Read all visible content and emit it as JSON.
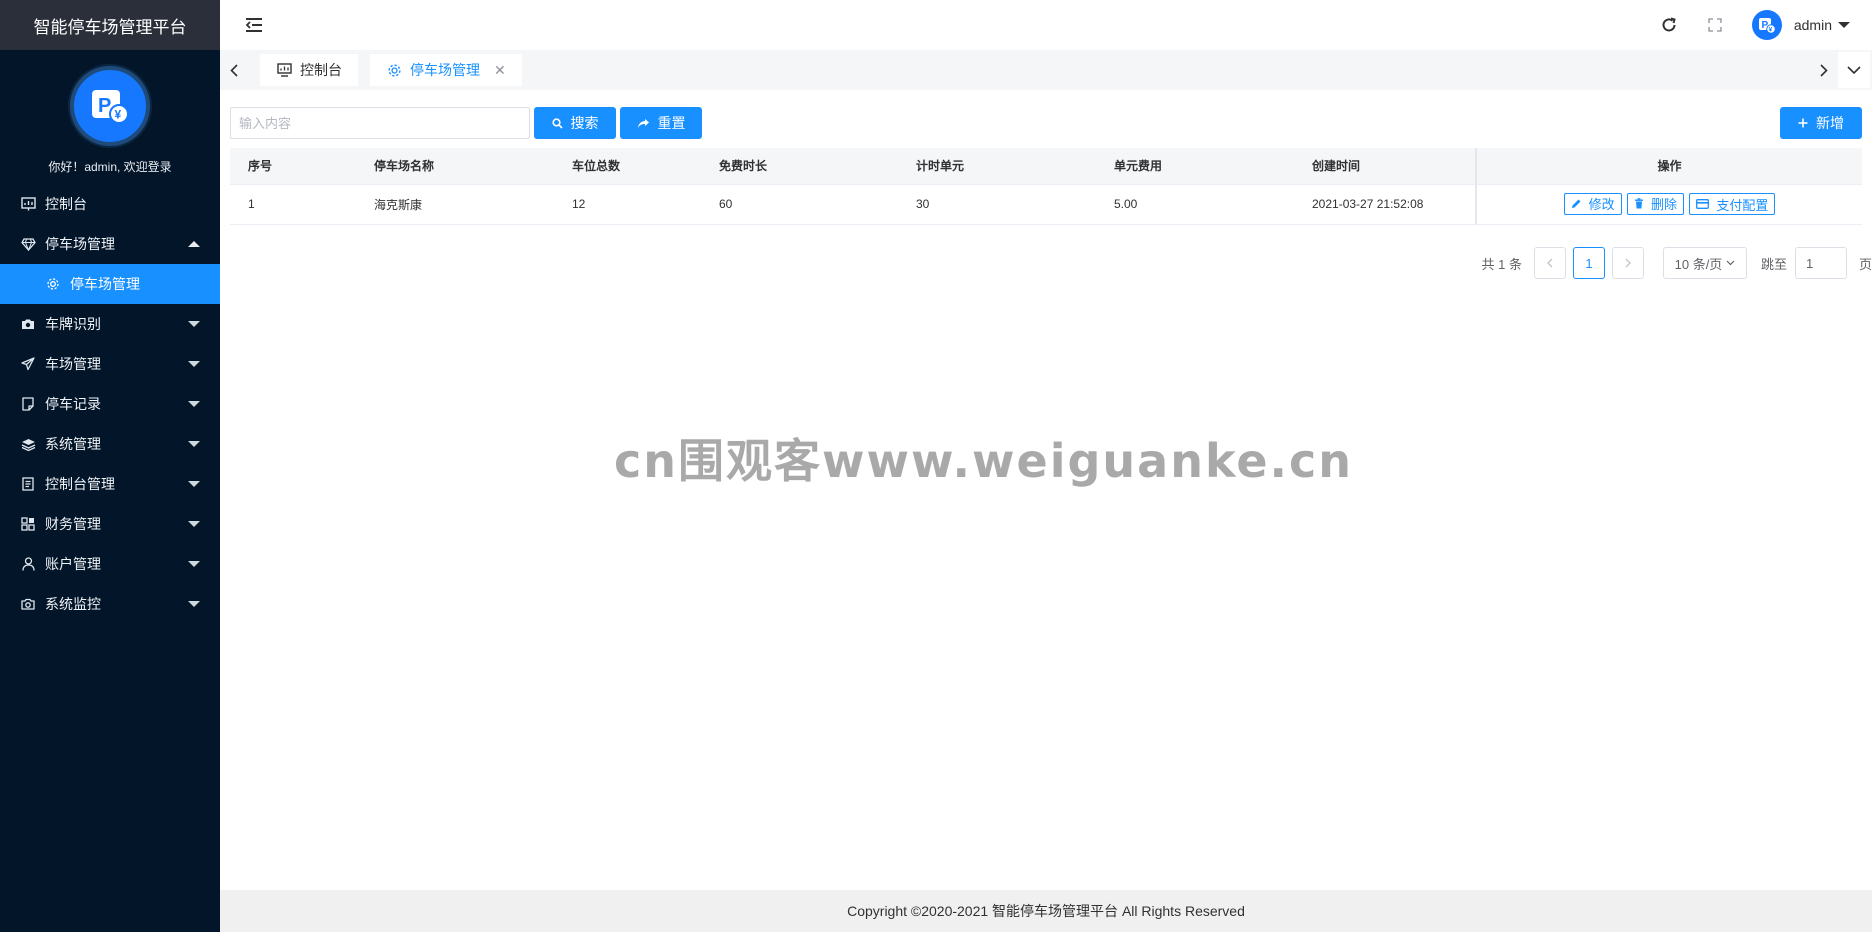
{
  "app": {
    "title": "智能停车场管理平台",
    "greeting": "你好！admin, 欢迎登录"
  },
  "sidebar": {
    "items": [
      {
        "label": "控制台",
        "icon": "dashboard-icon"
      },
      {
        "label": "停车场管理",
        "icon": "diamond-icon",
        "expanded": true
      },
      {
        "label": "停车场管理",
        "icon": "gear-icon",
        "active": true
      },
      {
        "label": "车牌识别",
        "icon": "camera-icon"
      },
      {
        "label": "车场管理",
        "icon": "send-icon"
      },
      {
        "label": "停车记录",
        "icon": "note-icon"
      },
      {
        "label": "系统管理",
        "icon": "layers-icon"
      },
      {
        "label": "控制台管理",
        "icon": "document-icon"
      },
      {
        "label": "财务管理",
        "icon": "grid-icon"
      },
      {
        "label": "账户管理",
        "icon": "user-icon"
      },
      {
        "label": "系统监控",
        "icon": "camera-outline-icon"
      }
    ]
  },
  "header": {
    "username": "admin"
  },
  "tabs": [
    {
      "label": "控制台",
      "icon": "monitor-icon"
    },
    {
      "label": "停车场管理",
      "icon": "gear-icon",
      "active": true
    }
  ],
  "toolbar": {
    "search_placeholder": "输入内容",
    "search_label": "搜索",
    "reset_label": "重置",
    "add_label": "新增"
  },
  "table": {
    "columns": [
      "序号",
      "停车场名称",
      "车位总数",
      "免费时长",
      "计时单元",
      "单元费用",
      "创建时间",
      "操作"
    ],
    "rows": [
      {
        "index": "1",
        "name": "海克斯康",
        "total_spaces": "12",
        "free_duration": "60",
        "time_unit": "30",
        "unit_fee": "5.00",
        "created": "2021-03-27 21:52:08"
      }
    ],
    "actions": {
      "edit": "修改",
      "delete": "删除",
      "pay_config": "支付配置"
    }
  },
  "pagination": {
    "total": "共 1 条",
    "current_page": "1",
    "page_size": "10 条/页",
    "jump_label": "跳至",
    "jump_value": "1",
    "page_suffix": "页"
  },
  "watermark": "cn围观客www.weiguanke.cn",
  "footer": "Copyright ©2020-2021 智能停车场管理平台 All Rights Reserved",
  "colors": {
    "sidebar_bg": "#031529",
    "accent": "#1890ff",
    "brand_bar": "#2b2f3a"
  }
}
